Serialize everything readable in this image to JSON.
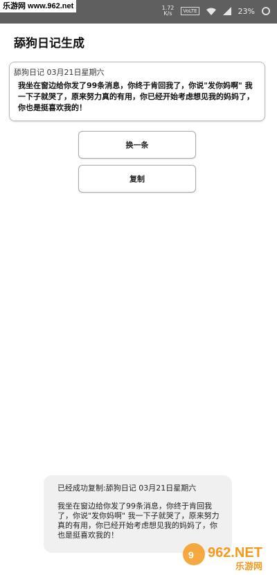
{
  "watermark_top": "乐游网 www.962.net",
  "status_bar": {
    "network_speed_value": "1.72",
    "network_speed_unit": "K/s",
    "volte_label": "VoLTE",
    "battery_percent": "23%"
  },
  "page_title": "舔狗日记生成",
  "diary": {
    "header": "舔狗日记 03月21日星期六",
    "body": "我坐在窗边给你发了99条消息，你终于肯回我了，你说\"发你妈啊\" 我一下子就哭了，原来努力真的有用，你已经开始考虑想见我的妈妈了，你也是挺喜欢我的！"
  },
  "buttons": {
    "change_label": "换一条",
    "copy_label": "复制"
  },
  "toast": {
    "title": "已经成功复制:舔狗日记 03月21日星期六",
    "body": "我坐在窗边给你发了99条消息，你终于肯回我了，你说\"发你妈啊\" 我一下子就哭了，原来努力真的有用，你已经开始考虑想见我的妈妈了，你也是挺喜欢我的！"
  },
  "watermark_logo": {
    "brand": "962.NET",
    "cn": "乐游网"
  },
  "colors": {
    "status_bar": "#5f5f5f",
    "toast_bg": "#f0f0f0",
    "logo_orange": "#f39a1e"
  }
}
